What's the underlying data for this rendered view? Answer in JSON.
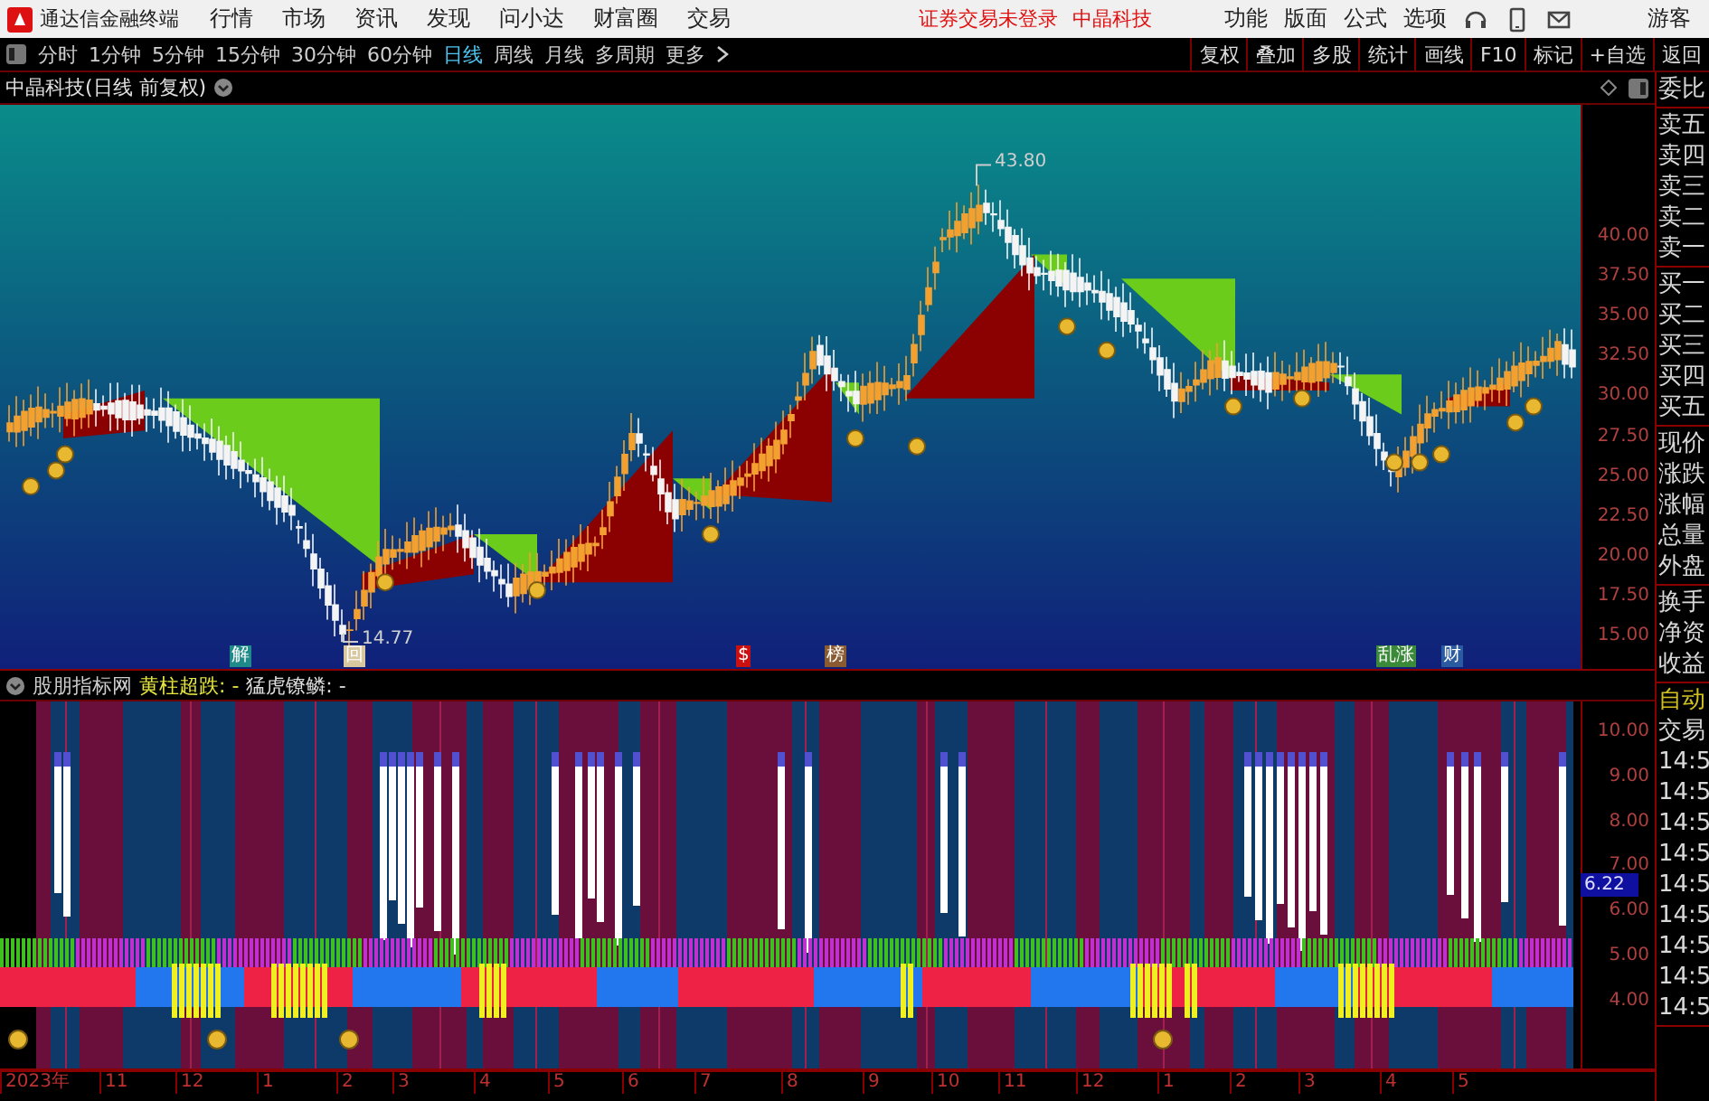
{
  "menu_bar": {
    "app_title": "通达信金融终端",
    "menus": [
      "行情",
      "市场",
      "资讯",
      "发现",
      "问小达",
      "财富圈",
      "交易"
    ],
    "notice": "证券交易未登录",
    "stock": "中晶科技",
    "tools": [
      "功能",
      "版面",
      "公式",
      "选项"
    ],
    "user": "游客"
  },
  "period_bar": {
    "periods": [
      {
        "label": "分时",
        "selected": false
      },
      {
        "label": "1分钟",
        "selected": false
      },
      {
        "label": "5分钟",
        "selected": false
      },
      {
        "label": "15分钟",
        "selected": false
      },
      {
        "label": "30分钟",
        "selected": false
      },
      {
        "label": "60分钟",
        "selected": false
      },
      {
        "label": "日线",
        "selected": true
      },
      {
        "label": "周线",
        "selected": false
      },
      {
        "label": "月线",
        "selected": false
      },
      {
        "label": "多周期",
        "selected": false
      }
    ],
    "more": "更多",
    "actions": [
      "复权",
      "叠加",
      "多股",
      "统计",
      "画线",
      "F10",
      "标记",
      "+自选",
      "返回"
    ]
  },
  "main_chart": {
    "title": "中晶科技(日线 前复权)",
    "price_axis": [
      "40.00",
      "37.50",
      "35.00",
      "32.50",
      "30.00",
      "27.50",
      "25.00",
      "22.50",
      "20.00",
      "17.50",
      "15.00"
    ],
    "high_label": "43.80",
    "low_label": "14.77",
    "event_markers": [
      {
        "label": "解",
        "color": "#1f8a8a"
      },
      {
        "label": "回",
        "color": "#d8c8a0"
      },
      {
        "label": "$",
        "color": "#cc1010"
      },
      {
        "label": "榜",
        "color": "#8a5a30"
      },
      {
        "label": "乱涨",
        "color": "#3a8a3a"
      },
      {
        "label": "财",
        "color": "#2a5aa0"
      }
    ]
  },
  "indicator": {
    "name": "股朋指标网",
    "param_1": "黄柱超跌: -",
    "param_2": "猛虎镣鳞: -",
    "axis": [
      "10.00",
      "9.00",
      "8.00",
      "7.00",
      "6.00",
      "5.00",
      "4.00"
    ],
    "current_value": "6.22"
  },
  "date_axis": [
    "2023年",
    "11",
    "12",
    "1",
    "2",
    "3",
    "4",
    "5",
    "6",
    "7",
    "8",
    "9",
    "10",
    "11",
    "12",
    "1",
    "2",
    "3",
    "4",
    "5"
  ],
  "quote_panel": {
    "groups": [
      [
        "委比"
      ],
      [
        "卖五",
        "卖四",
        "卖三",
        "卖二",
        "卖一"
      ],
      [
        "买一",
        "买二",
        "买三",
        "买四",
        "买五"
      ],
      [
        "现价",
        "涨跌",
        "涨幅",
        "总量",
        "外盘"
      ],
      [
        "换手",
        "净资",
        "收益"
      ]
    ],
    "auto_label": "自动",
    "trade_label": "交易",
    "times": [
      "14:5",
      "14:5",
      "14:5",
      "14:5",
      "14:5",
      "14:5",
      "14:5",
      "14:5",
      "14:5"
    ]
  }
}
